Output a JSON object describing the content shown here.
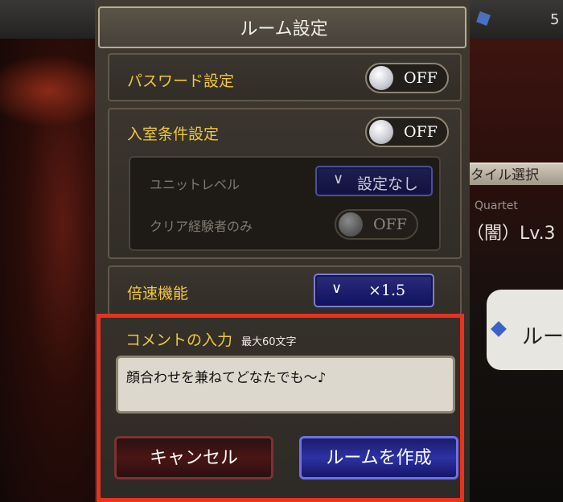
{
  "dialog": {
    "title": "ルーム設定",
    "password": {
      "label": "パスワード設定",
      "toggle": "OFF"
    },
    "entry_conditions": {
      "label": "入室条件設定",
      "toggle": "OFF",
      "unit_level": {
        "label": "ユニットレベル",
        "value": "設定なし",
        "chevron": "∨"
      },
      "clear_only": {
        "label": "クリア経験者のみ",
        "toggle": "OFF"
      }
    },
    "speed": {
      "label": "倍速機能",
      "value": "×1.5",
      "chevron": "∨"
    },
    "comment": {
      "label": "コメントの入力",
      "limit": "最大60文字",
      "value": "顔合わせを兼ねてどなたでも〜♪"
    },
    "buttons": {
      "cancel": "キャンセル",
      "create": "ルームを作成"
    }
  },
  "background": {
    "tab_label": "タイル選択",
    "sub_label": "Quartet",
    "level_text": "（闇）Lv.3",
    "card_text": "ルー",
    "top_number": "5"
  },
  "colors": {
    "accent_gold": "#f1c73c",
    "highlight_red": "#e8321f",
    "select_blue": "#2e31a4",
    "cancel_red": "#4a1515"
  }
}
